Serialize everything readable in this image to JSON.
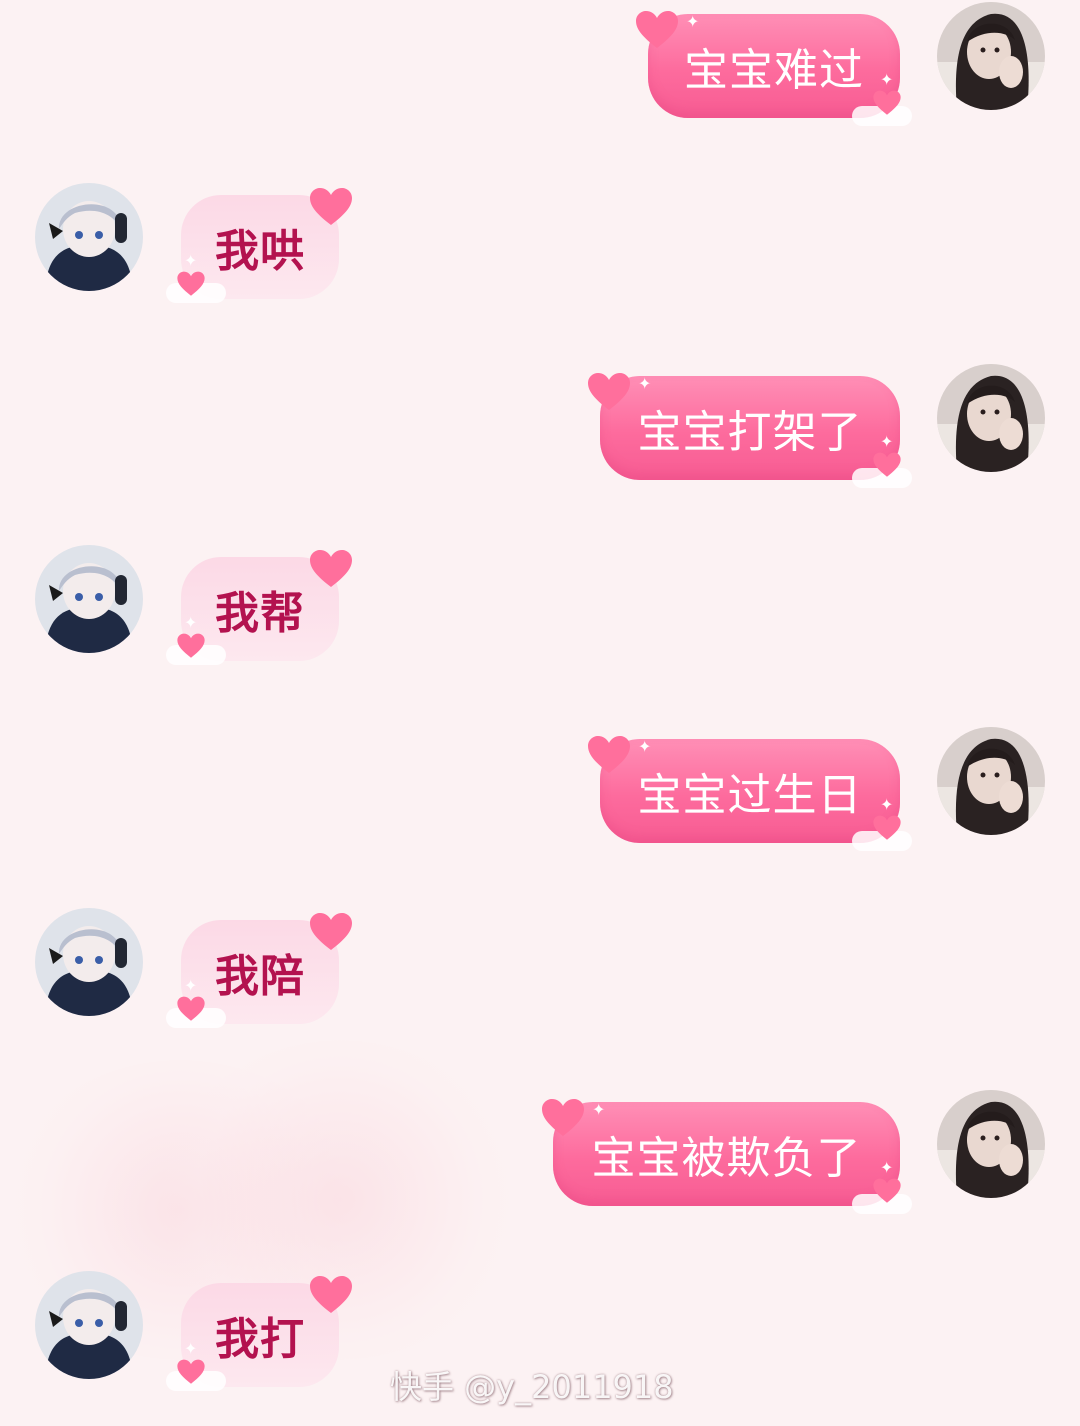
{
  "messages": [
    {
      "side": "me",
      "text": "宝宝难过",
      "avatar": "girl-avatar"
    },
    {
      "side": "other",
      "text": "我哄",
      "avatar": "anime-avatar"
    },
    {
      "side": "me",
      "text": "宝宝打架了",
      "avatar": "girl-avatar"
    },
    {
      "side": "other",
      "text": "我帮",
      "avatar": "anime-avatar"
    },
    {
      "side": "me",
      "text": "宝宝过生日",
      "avatar": "girl-avatar"
    },
    {
      "side": "other",
      "text": "我陪",
      "avatar": "anime-avatar"
    },
    {
      "side": "me",
      "text": "宝宝被欺负了",
      "avatar": "girl-avatar"
    },
    {
      "side": "other",
      "text": "我打",
      "avatar": "anime-avatar"
    }
  ],
  "watermark": "快手 @y_2011918",
  "colors": {
    "background": "#fcf2f3",
    "my_bubble": "#fd6b9d",
    "other_bubble": "#fcd9e6",
    "other_text": "#b3124f",
    "heart": "#ff6f9c"
  }
}
